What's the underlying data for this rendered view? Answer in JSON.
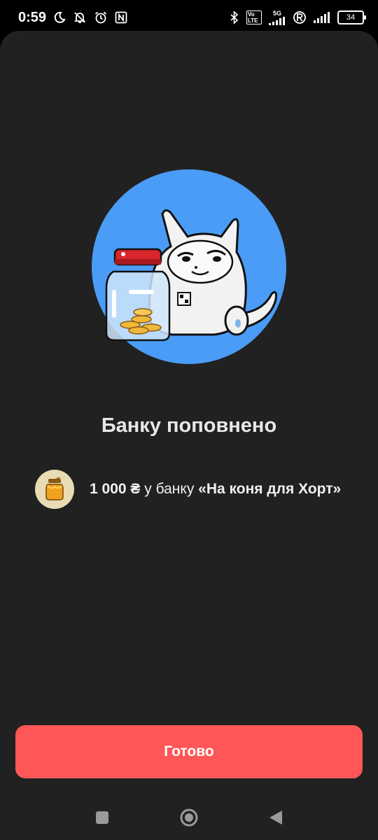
{
  "status_bar": {
    "time": "0:59",
    "network_label": "5G",
    "volte_label": "Vo LTE",
    "battery": "34",
    "icons": [
      "moon-icon",
      "bell-off-icon",
      "alarm-icon",
      "nfc-icon",
      "bluetooth-icon",
      "volte-icon",
      "signal-icon",
      "roaming-icon",
      "signal-icon",
      "battery-icon"
    ]
  },
  "main": {
    "title": "Банку поповнено",
    "amount": "1 000 ₴",
    "connector": " у банку ",
    "jar_name": "«На коня для Хорт»"
  },
  "done_button": {
    "label": "Готово"
  },
  "nav_bar": {
    "icons": [
      "recent-apps-icon",
      "home-icon",
      "back-icon"
    ]
  },
  "colors": {
    "sheet_background": "#212121",
    "accent_button": "#ff5757",
    "illustration_circle": "#4a9cf6",
    "avatar_background": "#e8dcb2"
  }
}
